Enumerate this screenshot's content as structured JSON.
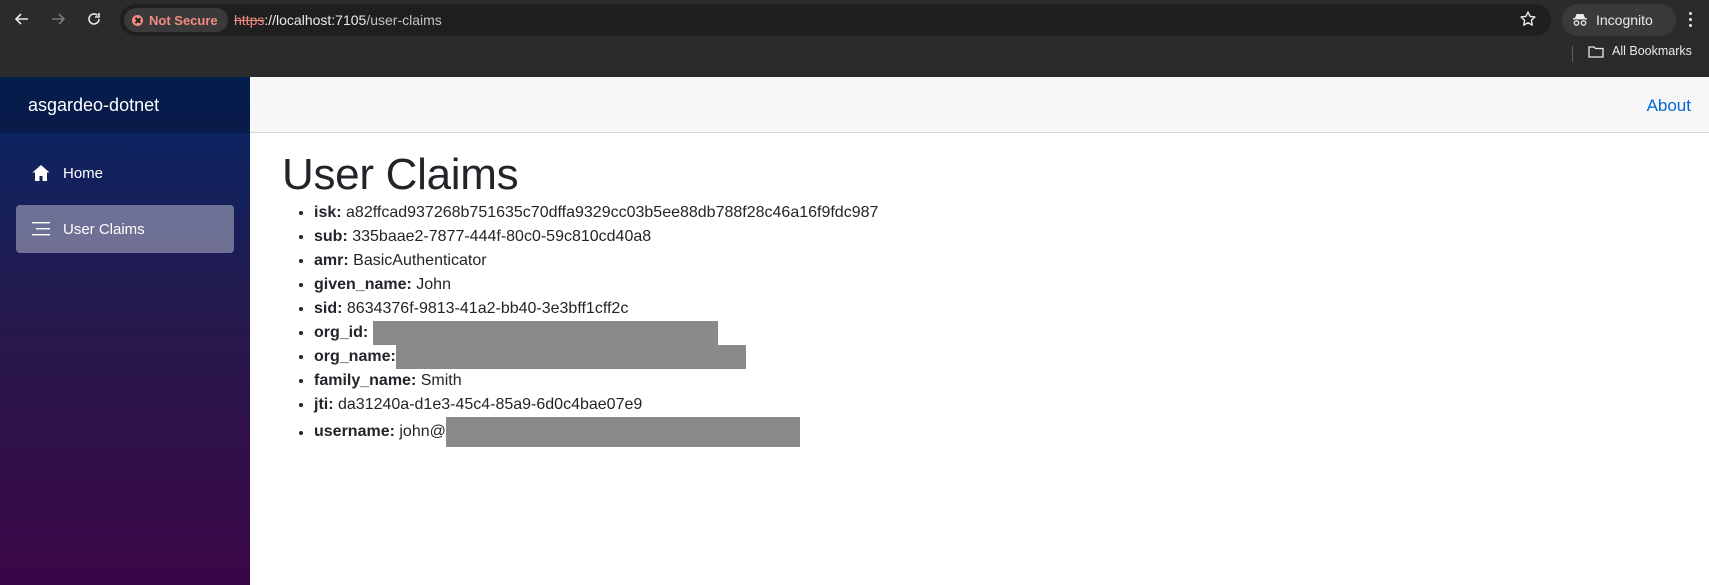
{
  "browser": {
    "security_label": "Not Secure",
    "url_scheme": "https",
    "url_host": "://localhost:7105",
    "url_path": "/user-claims",
    "incognito_label": "Incognito",
    "bookmarks_label": "All Bookmarks"
  },
  "sidebar": {
    "brand": "asgardeo-dotnet",
    "items": [
      {
        "label": "Home",
        "icon": "home-icon",
        "active": false
      },
      {
        "label": "User Claims",
        "icon": "list-icon",
        "active": true
      }
    ]
  },
  "header": {
    "about_label": "About"
  },
  "main": {
    "title": "User Claims",
    "claims": [
      {
        "key": "isk:",
        "value": "a82ffcad937268b751635c70dffa9329cc03b5ee88db788f28c46a16f9fdc987",
        "redacted": false
      },
      {
        "key": "sub:",
        "value": "335baae2-7877-444f-80c0-59c810cd40a8",
        "redacted": false
      },
      {
        "key": "amr:",
        "value": "BasicAuthenticator",
        "redacted": false
      },
      {
        "key": "given_name:",
        "value": "John",
        "redacted": false
      },
      {
        "key": "sid:",
        "value": "8634376f-9813-41a2-bb40-3e3bff1cff2c",
        "redacted": false
      },
      {
        "key": "org_id:",
        "value": "",
        "redacted": true
      },
      {
        "key": "org_name:",
        "value": "",
        "redacted": true
      },
      {
        "key": "family_name:",
        "value": "Smith",
        "redacted": false
      },
      {
        "key": "jti:",
        "value": "da31240a-d1e3-45c4-85a9-6d0c4bae07e9",
        "redacted": false
      },
      {
        "key": "username:",
        "value": "john@",
        "redacted": true
      }
    ]
  },
  "colors": {
    "link": "#0366d6",
    "redaction": "#8a8a8a",
    "not_secure": "#f28b82"
  }
}
